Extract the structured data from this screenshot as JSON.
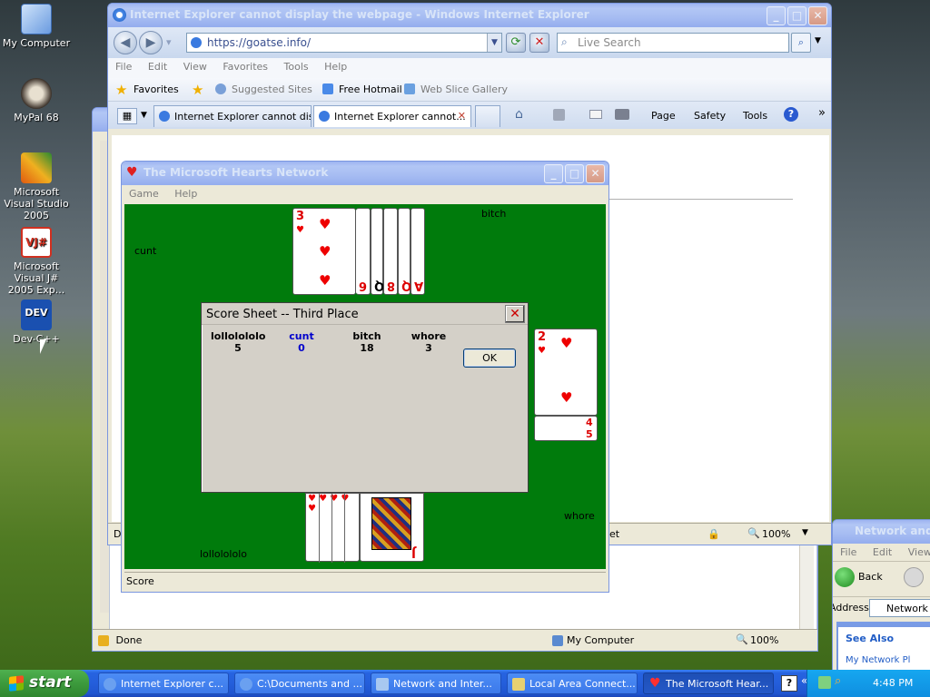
{
  "desktop": {
    "icons": [
      {
        "label": "My Computer"
      },
      {
        "label": "MyPal 68"
      },
      {
        "label": "Microsoft Visual Studio 2005"
      },
      {
        "label": "Microsoft Visual J# 2005 Exp..."
      },
      {
        "label": "Dev-C++"
      }
    ]
  },
  "ie_window": {
    "title": "Internet Explorer cannot display the webpage - Windows Internet Explorer",
    "address": "https://goatse.info/",
    "search_placeholder": "Live Search",
    "menu": [
      "File",
      "Edit",
      "View",
      "Favorites",
      "Tools",
      "Help"
    ],
    "favorites_label": "Favorites",
    "fav_items": [
      "Suggested Sites",
      "Free Hotmail",
      "Web Slice Gallery"
    ],
    "tabs": [
      "Internet Explorer cannot dis...",
      "Internet Explorer cannot..."
    ],
    "commands": [
      "Page",
      "Safety",
      "Tools"
    ],
    "status_left": "Do",
    "status_mid": "et",
    "zoom": "100%"
  },
  "back_ie_window": {
    "status": "Done",
    "zone": "My Computer",
    "zoom": "100%"
  },
  "network_window": {
    "title": "Network and In",
    "menu": [
      "File",
      "Edit",
      "View"
    ],
    "back_label": "Back",
    "address_label": "Address",
    "address_value": "Network a",
    "see_also": "See Also",
    "link": "My Network Pl"
  },
  "hearts": {
    "title": "The Microsoft Hearts Network",
    "menu": [
      "Game",
      "Help"
    ],
    "players": {
      "north": "bitch",
      "west": "cunt",
      "east": "whore",
      "south": "lollolololo"
    },
    "north_cards": [
      "3",
      "6",
      "Q",
      "8",
      "Q",
      "A"
    ],
    "east_card": "2",
    "east_stack": [
      "2",
      "4",
      "5"
    ],
    "south_cards": [
      "J"
    ],
    "status": "Score"
  },
  "score_dialog": {
    "title": "Score Sheet -- Third Place",
    "columns": [
      {
        "name": "lollolololo",
        "score": "5"
      },
      {
        "name": "cunt",
        "score": "0"
      },
      {
        "name": "bitch",
        "score": "18"
      },
      {
        "name": "whore",
        "score": "3"
      }
    ],
    "ok_label": "OK",
    "highlight_color": "#0000cc"
  },
  "taskbar": {
    "start": "start",
    "tasks": [
      "Internet Explorer c...",
      "C:\\Documents and ...",
      "Network and Inter...",
      "Local Area Connect...",
      "The Microsoft Hear..."
    ],
    "clock": "4:48 PM"
  }
}
